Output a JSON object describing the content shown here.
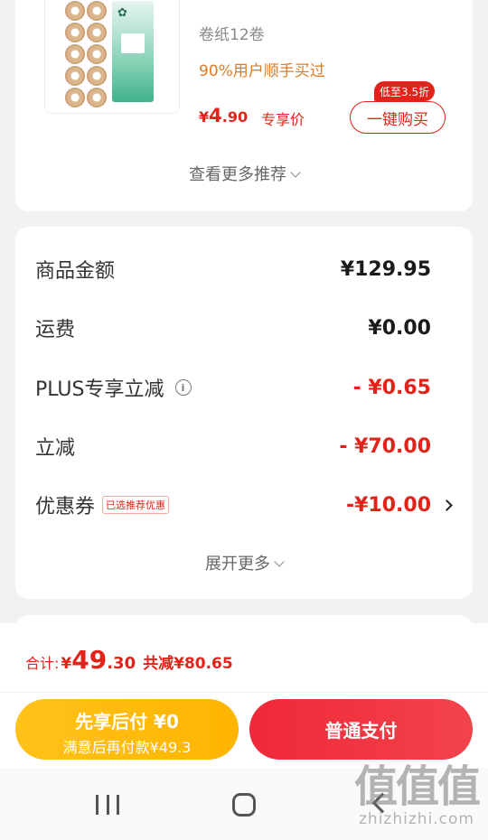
{
  "product": {
    "title": "卷纸12卷",
    "buyers_text": "90%用户顺手买过",
    "price_symbol": "¥",
    "price_int": "4",
    "price_dec": ".90",
    "price_tag": "专享价",
    "buy_button": "一键购买",
    "buy_badge": "低至3.5折",
    "more_recommendations": "查看更多推荐"
  },
  "summary": {
    "rows": [
      {
        "label": "商品金额",
        "value": "¥129.95"
      },
      {
        "label": "运费",
        "value": "¥0.00"
      },
      {
        "label": "PLUS专享立减",
        "value": "- ¥0.65"
      },
      {
        "label": "立减",
        "value": "- ¥70.00"
      },
      {
        "label": "优惠券",
        "value": "-¥10.00",
        "badge": "已选推荐优惠"
      }
    ],
    "expand_more": "展开更多"
  },
  "footer": {
    "total_label": "合计:",
    "total_symbol": "¥",
    "total_int": "49",
    "total_dec": ".30",
    "total_saved": "共减¥80.65",
    "pay_later_line1": "先享后付 ¥0",
    "pay_later_line2": "满意后再付款¥49.3",
    "pay_normal": "普通支付"
  },
  "watermark": {
    "logo": "值值值",
    "url": "zhizhizhi.com"
  },
  "colors": {
    "accent_red": "#e2231a",
    "accent_orange": "#e07b24",
    "pay_later_yellow": "#ffb400"
  }
}
